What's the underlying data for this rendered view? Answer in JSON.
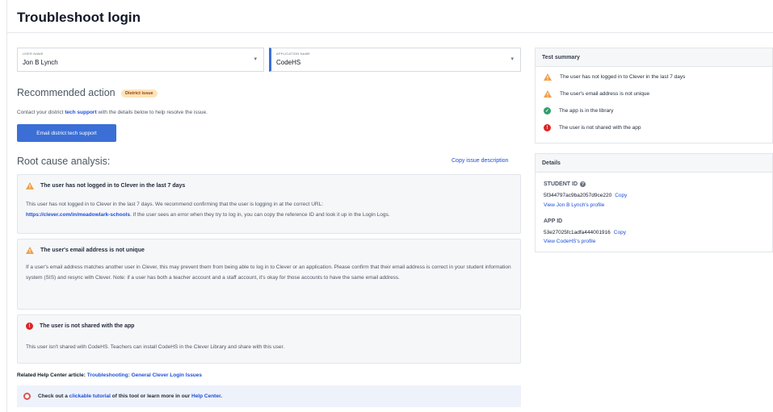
{
  "page": {
    "title": "Troubleshoot login"
  },
  "user_select": {
    "label": "USER NAME",
    "value": "Jon B Lynch"
  },
  "app_select": {
    "label": "APPLICATION NAME",
    "value": "CodeHS"
  },
  "recommended": {
    "title": "Recommended action",
    "badge": "District issue",
    "text_before": "Contact your district ",
    "link": "tech support",
    "text_after": " with the details below to help resolve the issue.",
    "button": "Email district tech support"
  },
  "rca": {
    "title": "Root cause analysis:",
    "copy_link": "Copy issue description",
    "cards": [
      {
        "title": "The user has not logged in to Clever in the last 7 days",
        "body_1": "This user has not logged in to Clever in the last 7 days. We recommend confirming that the user is logging in at the correct URL:",
        "url": "https://clever.com/in/meadowlark-schools",
        "body_2": ". If the user sees an error when they try to log in, you can copy the reference ID and look it up in the Login Logs."
      },
      {
        "title": "The user's email address is not unique",
        "body": "If a user's email address matches another user in Clever, this may prevent them from being able to log in to Clever or an application. Please confirm that their email address is correct in your student information system (SIS) and resync with Clever. Note: if a user has both a teacher account and a staff account, it's okay for those accounts to have the same email address."
      },
      {
        "title": "The user is not shared with the app",
        "body": "This user isn't shared with CodeHS. Teachers can install CodeHS in the Clever Library and share with this user."
      }
    ]
  },
  "related": {
    "label": "Related Help Center article: ",
    "link": "Troubleshooting: General Clever Login Issues"
  },
  "tutorial": {
    "text_1": "Check out a ",
    "link_1": "clickable tutorial",
    "text_2": " of this tool or learn more in our ",
    "link_2": "Help Center",
    "text_3": "."
  },
  "summary": {
    "title": "Test summary",
    "items": [
      {
        "text": "The user has not logged in to Clever in the last 7 days",
        "status": "warning"
      },
      {
        "text": "The user's email address is not unique",
        "status": "warning"
      },
      {
        "text": "The app is in the library",
        "status": "success"
      },
      {
        "text": "The user is not shared with the app",
        "status": "error"
      }
    ]
  },
  "details": {
    "title": "Details",
    "student_label": "STUDENT ID",
    "student_id": "5f344797ac9ba2057d9ce220",
    "student_copy": "Copy",
    "student_profile": "View Jon B Lynch's profile",
    "app_label": "APP ID",
    "app_id": "53e27025fc1adfa444001916",
    "app_copy": "Copy",
    "app_profile": "View CodeHS's profile"
  },
  "colors": {
    "accent": "#3b6fd6",
    "warning": "#f0a04b",
    "success": "#2e9e6b",
    "error": "#dc2626",
    "badge_bg": "#fde4b8"
  }
}
